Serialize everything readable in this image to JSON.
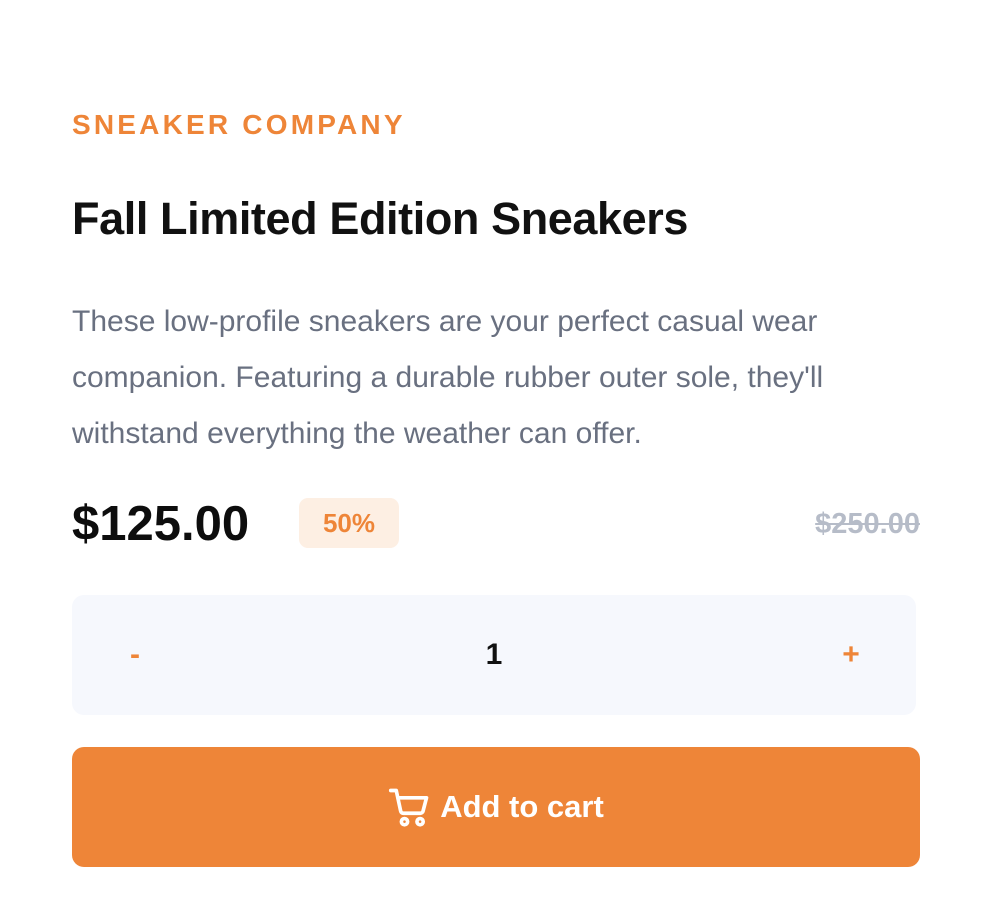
{
  "product": {
    "company": "SNEAKER COMPANY",
    "title": "Fall Limited Edition Sneakers",
    "description": "These low-profile sneakers are your perfect casual wear companion. Featuring a durable rubber outer sole, they'll withstand everything the weather can offer."
  },
  "pricing": {
    "price": "$125.00",
    "discount": "50%",
    "original_price": "$250.00"
  },
  "quantity": {
    "decrement_label": "-",
    "value": "1",
    "increment_label": "+"
  },
  "cart": {
    "button_label": "Add to cart",
    "icon": "cart-icon"
  },
  "colors": {
    "accent": "#EE8538",
    "accent_light": "#FDEFE3",
    "text_dark": "#111111",
    "text_muted": "#697080",
    "text_strike": "#B6BCC8",
    "qty_bg": "#F6F8FD"
  }
}
